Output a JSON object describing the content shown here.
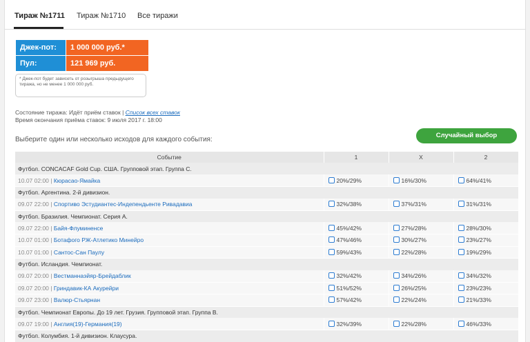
{
  "tabs": [
    {
      "label": "Тираж №1711",
      "active": true
    },
    {
      "label": "Тираж №1710",
      "active": false
    },
    {
      "label": "Все тиражи",
      "active": false
    }
  ],
  "jackpot": {
    "label": "Джек-пот:",
    "value": "1 000 000 руб.*",
    "pool_label": "Пул:",
    "pool_value": "121 969 руб."
  },
  "note": "* Джек-пот будет зависеть от розыгрыша предыдущего тиража, но не менее 1 000 000 руб.",
  "status": {
    "state_text": "Состояние тиража: Идёт приём ставок |",
    "bets_link": "Список всех ставок",
    "deadline_text": "Время окончания приёма ставок: 9 июля 2017 г. 18:00"
  },
  "prompt": "Выберите один или несколько исходов для каждого события:",
  "random_button": "Случайный выбор",
  "colors": {
    "accent_blue": "#1f8fd6",
    "accent_orange": "#f26522",
    "button_green": "#3ea43e"
  },
  "table": {
    "headers": [
      "Событие",
      "1",
      "X",
      "2"
    ],
    "rows": [
      {
        "type": "group",
        "title": "Футбол. CONCACAF Gold Cup. США. Групповой этап. Группа C."
      },
      {
        "type": "event",
        "time": "10.07 02:00",
        "name": "Кюрасао-Ямайка",
        "o1": "20%/29%",
        "ox": "16%/30%",
        "o2": "64%/41%"
      },
      {
        "type": "group",
        "title": "Футбол. Аргентина. 2-й дивизион."
      },
      {
        "type": "event",
        "time": "09.07 22:00",
        "name": "Спортиво Эстудиантес-Индепендьенте Ривадавиа",
        "o1": "32%/38%",
        "ox": "37%/31%",
        "o2": "31%/31%"
      },
      {
        "type": "group",
        "title": "Футбол. Бразилия. Чемпионат. Серия A."
      },
      {
        "type": "event",
        "time": "09.07 22:00",
        "name": "Байя-Флуминенсе",
        "o1": "45%/42%",
        "ox": "27%/28%",
        "o2": "28%/30%"
      },
      {
        "type": "event",
        "time": "10.07 01:00",
        "name": "Ботафого РЖ-Атлетико Минейро",
        "o1": "47%/46%",
        "ox": "30%/27%",
        "o2": "23%/27%"
      },
      {
        "type": "event",
        "time": "10.07 01:00",
        "name": "Сантос-Сан Паулу",
        "o1": "59%/43%",
        "ox": "22%/28%",
        "o2": "19%/29%"
      },
      {
        "type": "group",
        "title": "Футбол. Исландия. Чемпионат."
      },
      {
        "type": "event",
        "time": "09.07 20:00",
        "name": "Вестманнаэйяр-Брейдаблик",
        "o1": "32%/42%",
        "ox": "34%/26%",
        "o2": "34%/32%"
      },
      {
        "type": "event",
        "time": "09.07 20:00",
        "name": "Гриндавик-КА Акурейри",
        "o1": "51%/52%",
        "ox": "26%/25%",
        "o2": "23%/23%"
      },
      {
        "type": "event",
        "time": "09.07 23:00",
        "name": "Валюр-Стьярнан",
        "o1": "57%/42%",
        "ox": "22%/24%",
        "o2": "21%/33%"
      },
      {
        "type": "group",
        "title": "Футбол. Чемпионат Европы. До 19 лет. Грузия. Групповой этап. Группа B."
      },
      {
        "type": "event",
        "time": "09.07 19:00",
        "name": "Англия(19)-Германия(19)",
        "o1": "32%/39%",
        "ox": "22%/28%",
        "o2": "46%/33%"
      },
      {
        "type": "group",
        "title": "Футбол. Колумбия. 1-й дивизион. Клаусура."
      }
    ]
  }
}
